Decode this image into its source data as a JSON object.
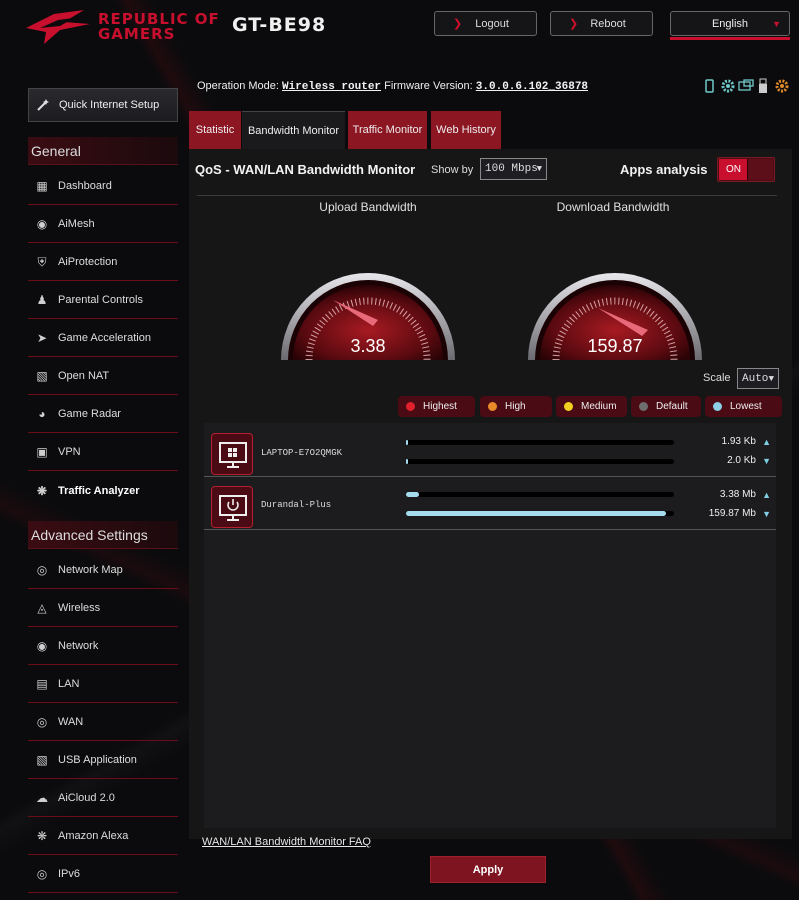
{
  "header": {
    "brand_line1": "REPUBLIC OF",
    "brand_line2": "GAMERS",
    "model": "GT-BE98",
    "logout_label": "Logout",
    "reboot_label": "Reboot",
    "language": "English"
  },
  "status": {
    "operation_mode_label": "Operation Mode:",
    "operation_mode": "Wireless router",
    "firmware_label": "Firmware Version:",
    "firmware_version": "3.0.0.6.102_36878"
  },
  "sidebar": {
    "quick_setup": "Quick Internet Setup",
    "general_title": "General",
    "general_items": [
      {
        "label": "Dashboard",
        "icon": "dashboard-icon"
      },
      {
        "label": "AiMesh",
        "icon": "aimesh-icon"
      },
      {
        "label": "AiProtection",
        "icon": "shield-icon"
      },
      {
        "label": "Parental Controls",
        "icon": "parental-icon"
      },
      {
        "label": "Game Acceleration",
        "icon": "rocket-icon"
      },
      {
        "label": "Open NAT",
        "icon": "open-nat-icon"
      },
      {
        "label": "Game Radar",
        "icon": "radar-icon"
      },
      {
        "label": "VPN",
        "icon": "vpn-icon"
      },
      {
        "label": "Traffic Analyzer",
        "icon": "traffic-analyzer-icon"
      }
    ],
    "advanced_title": "Advanced Settings",
    "advanced_items": [
      {
        "label": "Network Map",
        "icon": "globe-icon"
      },
      {
        "label": "Wireless",
        "icon": "wireless-icon"
      },
      {
        "label": "Network",
        "icon": "network-icon"
      },
      {
        "label": "LAN",
        "icon": "lan-icon"
      },
      {
        "label": "WAN",
        "icon": "wan-icon"
      },
      {
        "label": "USB Application",
        "icon": "usb-icon"
      },
      {
        "label": "AiCloud 2.0",
        "icon": "cloud-icon"
      },
      {
        "label": "Amazon Alexa",
        "icon": "alexa-icon"
      },
      {
        "label": "IPv6",
        "icon": "ipv6-icon"
      }
    ]
  },
  "tabs": [
    "Statistic",
    "Bandwidth Monitor",
    "Traffic Monitor",
    "Web History"
  ],
  "monitor": {
    "title": "QoS - WAN/LAN Bandwidth Monitor",
    "show_by_label": "Show by",
    "show_by_value": "100 Mbps",
    "apps_analysis_label": "Apps analysis",
    "apps_analysis_state": "ON",
    "upload_label": "Upload Bandwidth",
    "upload_value": "3.38",
    "download_label": "Download Bandwidth",
    "download_value": "159.87",
    "scale_label": "Scale",
    "scale_value": "Auto"
  },
  "legend": [
    {
      "label": "Highest",
      "color": "#e0202a"
    },
    {
      "label": "High",
      "color": "#e88a2a"
    },
    {
      "label": "Medium",
      "color": "#f0d020"
    },
    {
      "label": "Default",
      "color": "#6e6e6e"
    },
    {
      "label": "Lowest",
      "color": "#8ccfe6"
    }
  ],
  "devices": [
    {
      "name": "LAPTOP-E7O2QMGK",
      "icon": "windows-icon",
      "up": "1.93 Kb",
      "down": "2.0 Kb",
      "up_fill": 0.005,
      "down_fill": 0.005
    },
    {
      "name": "Durandal-Plus",
      "icon": "power-icon",
      "up": "3.38 Mb",
      "down": "159.87 Mb",
      "up_fill": 0.05,
      "down_fill": 0.97
    }
  ],
  "footer": {
    "faq_label": "WAN/LAN Bandwidth Monitor FAQ",
    "apply_label": "Apply"
  }
}
